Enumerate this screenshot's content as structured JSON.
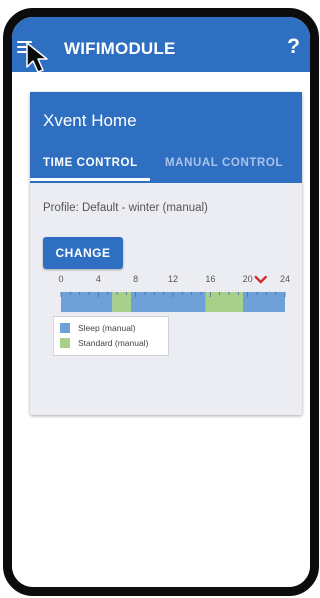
{
  "appbar": {
    "title": "WIFIMODULE",
    "help": "?",
    "menu_icon": "hamburger-menu-icon"
  },
  "card": {
    "title": "Xvent Home",
    "tabs": [
      {
        "label": "TIME CONTROL",
        "active": true
      },
      {
        "label": "MANUAL CONTROL",
        "active": false
      }
    ],
    "profile": "Profile: Default - winter (manual)",
    "change_label": "CHANGE"
  },
  "chart_data": {
    "type": "bar",
    "x_ticks": [
      "0",
      "4",
      "8",
      "12",
      "16",
      "20",
      "24"
    ],
    "xlim": [
      0,
      24
    ],
    "current_hour": 21.4,
    "segments": [
      {
        "start": 0,
        "end": 5.5,
        "mode": "Sleep (manual)"
      },
      {
        "start": 5.5,
        "end": 7.5,
        "mode": "Standard (manual)"
      },
      {
        "start": 7.5,
        "end": 15.5,
        "mode": "Sleep (manual)"
      },
      {
        "start": 15.5,
        "end": 19.5,
        "mode": "Standard (manual)"
      },
      {
        "start": 19.5,
        "end": 24,
        "mode": "Sleep (manual)"
      }
    ],
    "series": [
      {
        "name": "Sleep (manual)",
        "color": "#6fa0d8"
      },
      {
        "name": "Standard (manual)",
        "color": "#a8d08a"
      }
    ],
    "legend": [
      "Sleep (manual)",
      "Standard (manual)"
    ]
  },
  "colors": {
    "primary": "#2f6fc2",
    "sleep": "#6fa0d8",
    "standard": "#a8d08a",
    "marker": "#d42a2a"
  }
}
